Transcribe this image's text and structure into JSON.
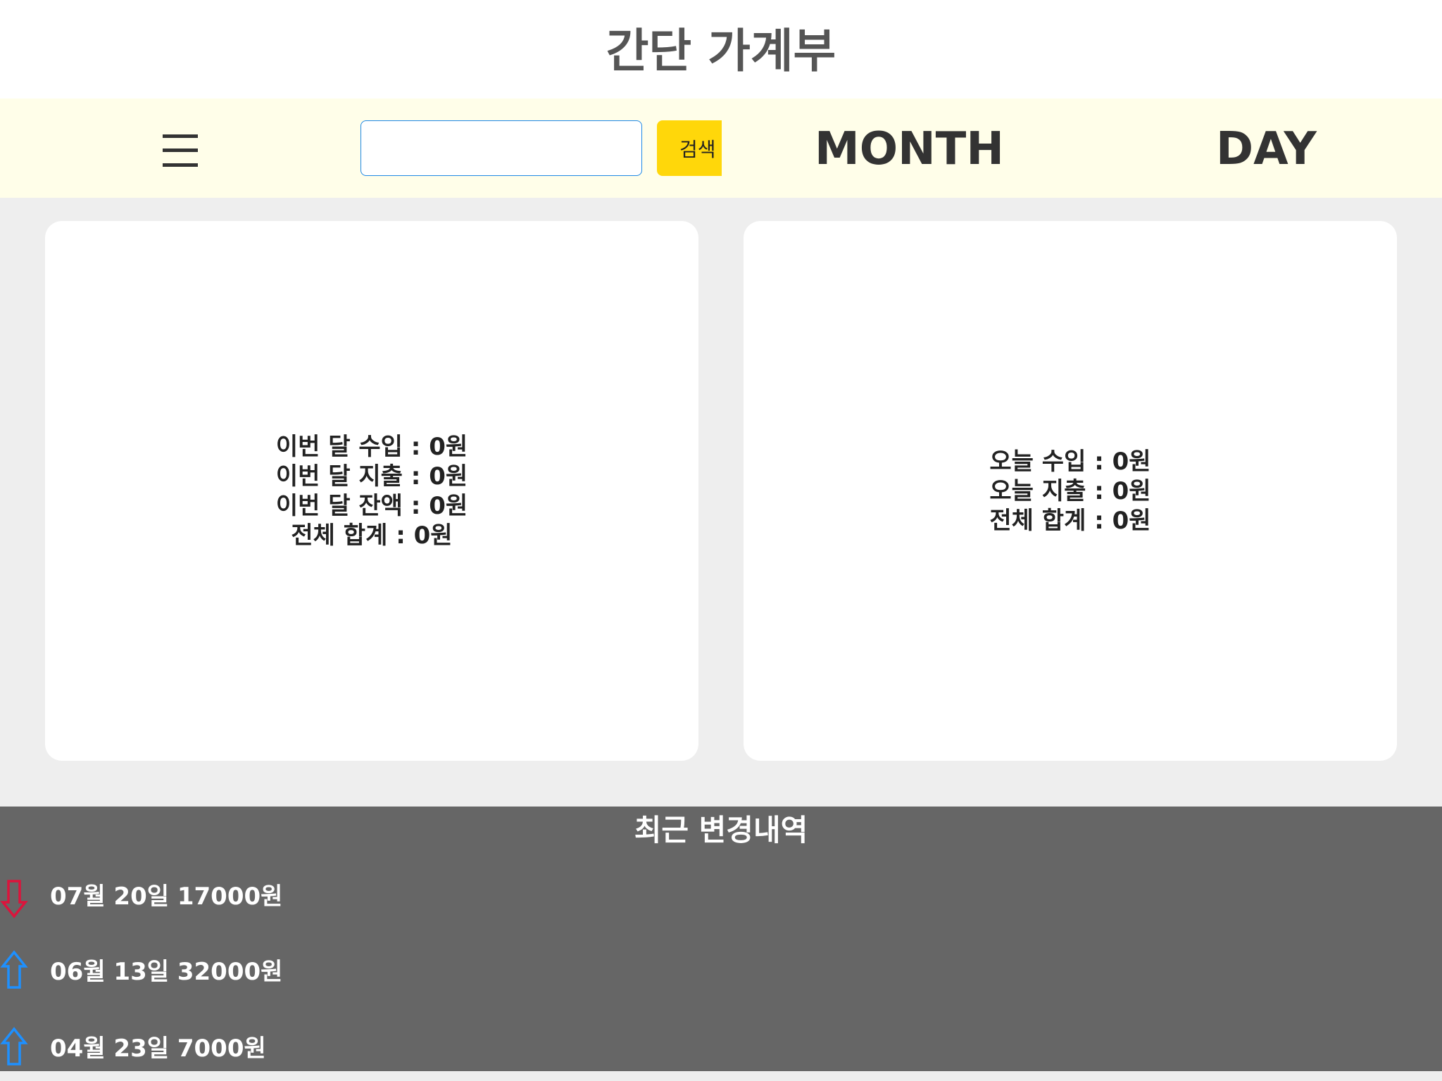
{
  "app": {
    "title": "간단 가계부"
  },
  "toolbar": {
    "menu_icon": "hamburger-menu-icon",
    "search": {
      "value": "",
      "placeholder": ""
    },
    "search_button_label": "검색",
    "nav": {
      "month_label": "MONTH",
      "day_label": "DAY"
    }
  },
  "month_card": {
    "income": "이번 달 수입 : 0원",
    "expense": "이번 달 지출 : 0원",
    "balance": "이번 달 잔액 : 0원",
    "total": "전체 합계 : 0원"
  },
  "day_card": {
    "income": "오늘 수입 : 0원",
    "expense": "오늘 지출 : 0원",
    "total": "전체 합계 : 0원"
  },
  "history": {
    "title": "최근 변경내역",
    "items": [
      {
        "text": "07월 20일 17000원",
        "direction": "down",
        "icon": "down-arrow-icon",
        "color": "#dc143c"
      },
      {
        "text": "06월 13일 32000원",
        "direction": "up",
        "icon": "up-arrow-icon",
        "color": "#1e90ff"
      },
      {
        "text": "04월 23일 7000원",
        "direction": "up",
        "icon": "up-arrow-icon",
        "color": "#1e90ff"
      }
    ]
  },
  "colors": {
    "title_background": "#ffffff",
    "toolbar_background": "#fffee9",
    "page_background": "#eeeeee",
    "card_background": "#ffffff",
    "search_button": "#ffd70a",
    "search_border": "#1e88e5",
    "history_background": "#666666",
    "expense_arrow": "#dc143c",
    "income_arrow": "#1e90ff"
  }
}
